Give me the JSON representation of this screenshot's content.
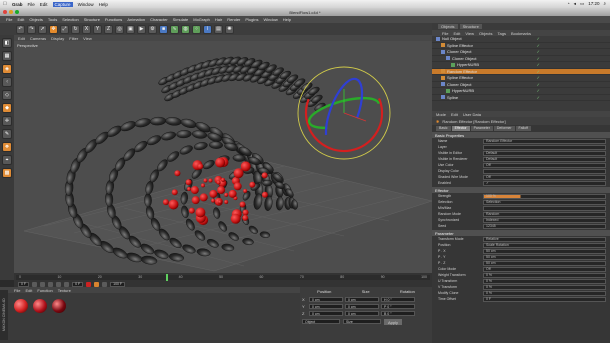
{
  "macbar": {
    "app": "Grab",
    "menus": [
      "File",
      "Edit",
      "Capture",
      "Window",
      "Help"
    ],
    "active_menu": "Capture",
    "clock": "17:20",
    "status_icons": [
      "wifi-icon",
      "volume-icon",
      "battery-icon",
      "spotlight-icon"
    ]
  },
  "window": {
    "title": "BlendFlow1.c4d *",
    "traffic_light_colors": [
      "#e0443e",
      "#dea123",
      "#1aab29"
    ]
  },
  "appmenu": [
    "File",
    "Edit",
    "Objects",
    "Tools",
    "Selection",
    "Structure",
    "Functions",
    "Animation",
    "Character",
    "Simulate",
    "MoGraph",
    "Hair",
    "Render",
    "Plugins",
    "Window",
    "Help"
  ],
  "toolbar": {
    "buttons": [
      "undo-icon",
      "redo-icon",
      "select-icon",
      "move-icon",
      "scale-icon",
      "rotate-icon",
      "x-axis-icon",
      "y-axis-icon",
      "z-axis-icon",
      "world-icon",
      "render-region-icon",
      "render-view-icon",
      "render-settings-icon",
      "cube-icon",
      "spline-icon",
      "nurbs-icon",
      "array-icon",
      "deformer-icon",
      "scene-icon",
      "light-icon"
    ]
  },
  "viewport": {
    "menu": [
      "Edit",
      "Cameras",
      "Display",
      "Filter",
      "View"
    ],
    "label": "Perspective"
  },
  "timeline": {
    "ticks": [
      "0",
      "10",
      "20",
      "30",
      "40",
      "50",
      "60",
      "70",
      "80",
      "90",
      "100"
    ],
    "current_frame_fraction": 0.36,
    "start_field": "0 F",
    "end_field": "100 F",
    "frame_field": "0 F"
  },
  "material": {
    "menu": [
      "File",
      "Edit",
      "Function",
      "Texture"
    ],
    "ball_colors": [
      "#d11f1f",
      "#b0101a",
      "#7a0710"
    ]
  },
  "coords": {
    "headers": [
      "Position",
      "Size",
      "Rotation"
    ],
    "rows": [
      {
        "axis": "X",
        "pos": "0 cm",
        "size": "0 cm",
        "rot": "H 0 °"
      },
      {
        "axis": "Y",
        "pos": "0 cm",
        "size": "0 cm",
        "rot": "P 0 °"
      },
      {
        "axis": "Z",
        "pos": "0 cm",
        "size": "0 cm",
        "rot": "B 0 °"
      }
    ],
    "mode": "Object",
    "size_mode": "Size",
    "apply": "Apply"
  },
  "objmgr": {
    "tabs": [
      "Objects",
      "Structure"
    ],
    "menu": [
      "File",
      "Edit",
      "View",
      "Objects",
      "Tags",
      "Bookmarks"
    ],
    "rows": [
      {
        "name": "Null Object",
        "indent": 0,
        "selected": false
      },
      {
        "name": "Spline Effector",
        "indent": 1,
        "selected": false
      },
      {
        "name": "Cloner Object",
        "indent": 1,
        "selected": false
      },
      {
        "name": "Cloner Object",
        "indent": 2,
        "selected": false
      },
      {
        "name": "HyperNURB",
        "indent": 3,
        "selected": false
      },
      {
        "name": "Random Effector",
        "indent": 1,
        "selected": true
      },
      {
        "name": "Spline Effector",
        "indent": 1,
        "selected": false
      },
      {
        "name": "Cloner Object",
        "indent": 1,
        "selected": false
      },
      {
        "name": "HyperNURB",
        "indent": 2,
        "selected": false
      },
      {
        "name": "Spline",
        "indent": 1,
        "selected": false
      }
    ]
  },
  "attr": {
    "menu": [
      "Mode",
      "Edit",
      "User Data"
    ],
    "title": "Random Effector [Random Effector]",
    "tabs": [
      "Basic",
      "Effector",
      "Parameter",
      "Deformer",
      "Falloff"
    ],
    "active_tab": "Effector",
    "sections": [
      {
        "title": "Basic Properties",
        "rows": [
          {
            "k": "Name",
            "v": "Random Effector"
          },
          {
            "k": "Layer",
            "v": ""
          },
          {
            "k": "Visible in Editor",
            "v": "Default"
          },
          {
            "k": "Visible in Renderer",
            "v": "Default"
          },
          {
            "k": "Use Color",
            "v": "Off"
          },
          {
            "k": "Display Color",
            "v": ""
          },
          {
            "k": "Shaded Wire Mode",
            "v": "Off"
          },
          {
            "k": "Enabled",
            "v": "✓"
          }
        ]
      },
      {
        "title": "Effector",
        "rows": [
          {
            "k": "Strength",
            "v": "100 %",
            "bar": true
          },
          {
            "k": "Selection",
            "v": "Selection"
          },
          {
            "k": "Min/Max",
            "v": ""
          },
          {
            "k": "Random Mode",
            "v": "Random"
          },
          {
            "k": "Synchronized",
            "v": "Indexed"
          },
          {
            "k": "Seed",
            "v": "12345"
          }
        ]
      },
      {
        "title": "Parameter",
        "rows": [
          {
            "k": "Transform Mode",
            "v": "Relative"
          },
          {
            "k": "Position",
            "v": "Scale   Rotation"
          },
          {
            "k": "P . X",
            "v": "50 cm"
          },
          {
            "k": "P . Y",
            "v": "50 cm"
          },
          {
            "k": "P . Z",
            "v": "50 cm"
          },
          {
            "k": "Color Mode",
            "v": "Off"
          },
          {
            "k": "Weight Transform",
            "v": "0 %"
          },
          {
            "k": "U Transform",
            "v": "0 %"
          },
          {
            "k": "V Transform",
            "v": "0 %"
          },
          {
            "k": "Modify Clone",
            "v": "0 %"
          },
          {
            "k": "Time Offset",
            "v": "0 F"
          }
        ]
      }
    ]
  },
  "bottom_label": "MAXON CINEMA 4D"
}
